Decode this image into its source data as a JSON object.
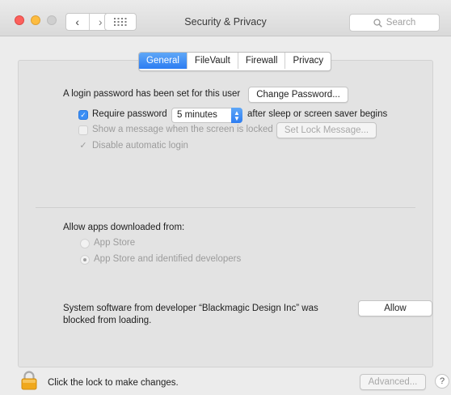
{
  "window": {
    "title": "Security & Privacy",
    "search_placeholder": "Search",
    "nav": {
      "back_glyph": "‹",
      "forward_glyph": "›"
    }
  },
  "tabs": [
    {
      "label": "General",
      "selected": true
    },
    {
      "label": "FileVault",
      "selected": false
    },
    {
      "label": "Firewall",
      "selected": false
    },
    {
      "label": "Privacy",
      "selected": false
    }
  ],
  "general": {
    "login_password_text": "A login password has been set for this user",
    "change_password_button": "Change Password...",
    "require_password": {
      "checked": true,
      "label": "Require password",
      "interval_value": "5 minutes",
      "suffix": "after sleep or screen saver begins"
    },
    "show_message": {
      "checked": false,
      "enabled": false,
      "label": "Show a message when the screen is locked",
      "button": "Set Lock Message..."
    },
    "disable_auto_login": {
      "checked": true,
      "enabled": false,
      "label": "Disable automatic login"
    }
  },
  "allow_apps": {
    "heading": "Allow apps downloaded from:",
    "options": [
      {
        "label": "App Store",
        "selected": false
      },
      {
        "label": "App Store and identified developers",
        "selected": true
      }
    ]
  },
  "blocked": {
    "line1": "System software from developer “Blackmagic Design Inc” was",
    "line2": "blocked from loading.",
    "allow_button": "Allow"
  },
  "footer": {
    "lock_text": "Click the lock to make changes.",
    "advanced_button": "Advanced...",
    "help_glyph": "?"
  },
  "colors": {
    "accent": "#3a8ef5",
    "close": "#fc605c",
    "minimize": "#fdbc40",
    "lock_body": "#f0a81c"
  }
}
